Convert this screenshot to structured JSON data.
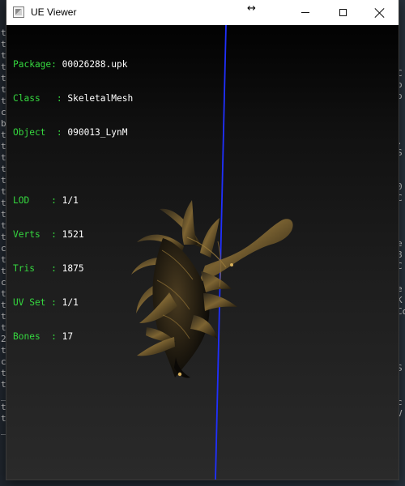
{
  "window": {
    "title": "UE Viewer"
  },
  "stats": [
    {
      "key": "Package",
      "value": "00026288.upk"
    },
    {
      "key": "Class",
      "value": "SkeletalMesh"
    },
    {
      "key": "Object",
      "value": "090013_LynM"
    },
    {
      "key": "LOD",
      "value": "1/1"
    },
    {
      "key": "Verts",
      "value": "1521"
    },
    {
      "key": "Tris",
      "value": "1875"
    },
    {
      "key": "UV Set",
      "value": "1/1"
    },
    {
      "key": "Bones",
      "value": "17"
    }
  ],
  "background_console": {
    "left_chars": [
      "t",
      "t",
      "t",
      "t",
      "t",
      "t",
      "t",
      "c",
      "b",
      "t",
      "t",
      "t",
      "t",
      "t",
      "t",
      "t",
      "t",
      "t",
      "t",
      "c",
      "t",
      "t",
      "c",
      "t",
      "t",
      "t",
      "t",
      "2",
      "t",
      "c",
      "t",
      "t",
      "_",
      "t",
      "t",
      "_"
    ],
    "right_chars": [
      "C",
      "o",
      "o",
      "",
      "",
      "",
      ".",
      "S",
      "",
      "",
      "0",
      "C",
      "",
      "",
      "",
      "e",
      "8",
      "C",
      "",
      "e",
      "K",
      "Co",
      "",
      "",
      "",
      "",
      "S",
      "",
      "",
      "c",
      "V",
      "",
      "",
      "",
      "",
      "",
      "",
      "",
      ""
    ]
  },
  "colors": {
    "label": "#35d83f",
    "value": "#ffffff",
    "axis": "#2030ff",
    "titlebar": "#ffffff"
  },
  "icons": {
    "app": "ue-viewer-icon",
    "resize": "horizontal-resize-cursor-icon",
    "minimize": "minimize-icon",
    "maximize": "maximize-icon",
    "close": "close-icon"
  }
}
